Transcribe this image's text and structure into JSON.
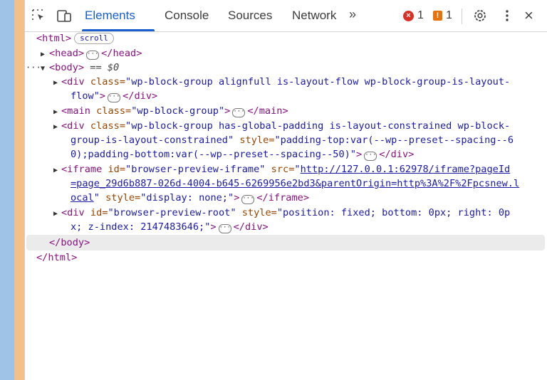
{
  "toolbar": {
    "tabs": [
      "Elements",
      "Console",
      "Sources",
      "Network"
    ],
    "more": "»",
    "errors": "1",
    "warnings": "1",
    "close": "×"
  },
  "tree": {
    "html_open": "<html>",
    "scroll_badge": "scroll",
    "head": "<head>",
    "head_close": "</head>",
    "body": "<body>",
    "body_eq": "== $0",
    "div1_open": "<div ",
    "div1_attr": "class=",
    "div1_val_a": "\"wp-block-group alignfull is-layout-flow wp-block-group-is-layout-",
    "div1_val_b": "flow\"",
    "div1_close": "</div>",
    "main_open": "<main ",
    "main_attr": "class=",
    "main_val": "\"wp-block-group\"",
    "main_close": "</main>",
    "div2_open": "<div ",
    "div2_attr": "class=",
    "div2_val_a": "\"wp-block-group has-global-padding is-layout-constrained wp-block-",
    "div2_val_b": "group-is-layout-constrained\"",
    "div2_style_attr": "style=",
    "div2_style_a": "\"padding-top:var(--wp--preset--spacing--6",
    "div2_style_b": "0);padding-bottom:var(--wp--preset--spacing--50)\"",
    "div2_close": "</div>",
    "iframe_open": "<iframe ",
    "iframe_id_attr": "id=",
    "iframe_id_val": "\"browser-preview-iframe\"",
    "iframe_src_attr": "src=",
    "iframe_src_a": "http://127.0.0.1:62978/iframe?pageId",
    "iframe_src_b": "=page_29d6b887-026d-4004-b645-6269956e2bd3&parentOrigin=http%3A%2F%2Fpcsnew.l",
    "iframe_src_c": "ocal",
    "iframe_style_attr": "style=",
    "iframe_style_val": "\"display: none;\"",
    "iframe_close": "</iframe>",
    "div3_open": "<div ",
    "div3_id_attr": "id=",
    "div3_id_val": "\"browser-preview-root\"",
    "div3_style_attr": "style=",
    "div3_style_a": "\"position: fixed; bottom: 0px; right: 0p",
    "div3_style_b": "x; z-index: 2147483646;\"",
    "div3_close": "</div>",
    "body_close": "</body>",
    "html_close": "</html>"
  },
  "colors": {
    "accent": "#1a5fd0",
    "tag": "#881280",
    "attr_name": "#994500",
    "attr_value": "#1a1aa6",
    "error": "#d93025",
    "warning": "#e8710a"
  }
}
